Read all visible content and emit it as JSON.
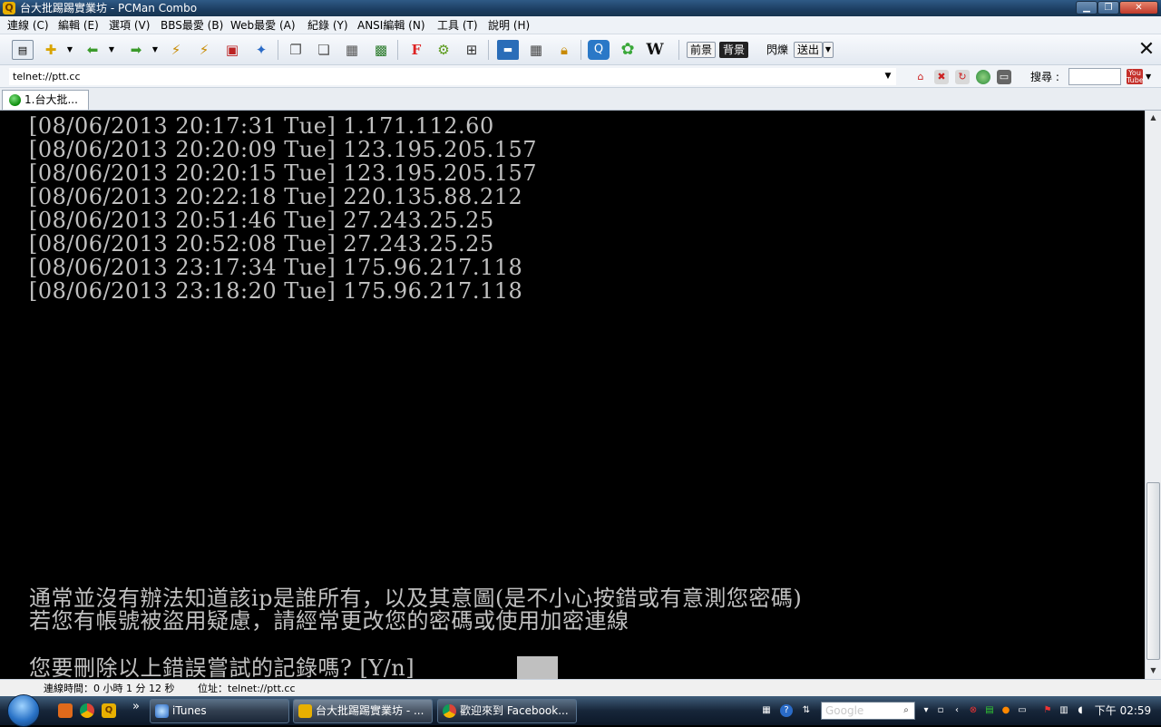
{
  "window": {
    "title": "台大批踢踢實業坊 - PCMan Combo",
    "app_icon": "pcman-icon"
  },
  "menu": [
    "連線 (C)",
    "編輯 (E)",
    "選項 (V)",
    "BBS最愛 (B)",
    "Web最愛 (A)",
    "紀錄 (Y)",
    "ANSI編輯 (N)",
    "工具 (T)",
    "說明 (H)"
  ],
  "toolbar": {
    "fg_label": "前景",
    "bg_label": "背景",
    "blink_label": "閃爍",
    "send_label": "送出"
  },
  "address": {
    "value": "telnet://ptt.cc",
    "search_label": "搜尋 :",
    "youtube_text": "You Tube"
  },
  "tabs": [
    {
      "label": "1.台大批..."
    }
  ],
  "terminal": {
    "log": [
      "[08/06/2013 20:17:31 Tue] 1.171.112.60",
      "[08/06/2013 20:20:09 Tue] 123.195.205.157",
      "[08/06/2013 20:20:15 Tue] 123.195.205.157",
      "[08/06/2013 20:22:18 Tue] 220.135.88.212",
      "[08/06/2013 20:51:46 Tue] 27.243.25.25",
      "[08/06/2013 20:52:08 Tue] 27.243.25.25",
      "[08/06/2013 23:17:34 Tue] 175.96.217.118",
      "[08/06/2013 23:18:20 Tue] 175.96.217.118"
    ],
    "notice_1": "通常並沒有辦法知道該ip是誰所有，以及其意圖(是不小心按錯或有意測您密碼)",
    "notice_2": "若您有帳號被盜用疑慮，請經常更改您的密碼或使用加密連線",
    "prompt": "您要刪除以上錯誤嘗試的記錄嗎? [Y/n]"
  },
  "status": {
    "connection_time": "連線時間：0 小時 1 分 12 秒",
    "address": "位址：telnet://ptt.cc"
  },
  "taskbar": {
    "tasks": [
      {
        "label": "iTunes",
        "icon": "itunes-icon"
      },
      {
        "label": "台大批踢踢實業坊 - ...",
        "icon": "pcman-icon"
      },
      {
        "label": "歡迎來到 Facebook...",
        "icon": "chrome-icon"
      }
    ],
    "search_placeholder": "Google",
    "clock": "下午 02:59"
  },
  "colors": {
    "terminal_bg": "#000000",
    "terminal_fg": "#c0c0c0",
    "titlebar": "#1c3d61"
  }
}
